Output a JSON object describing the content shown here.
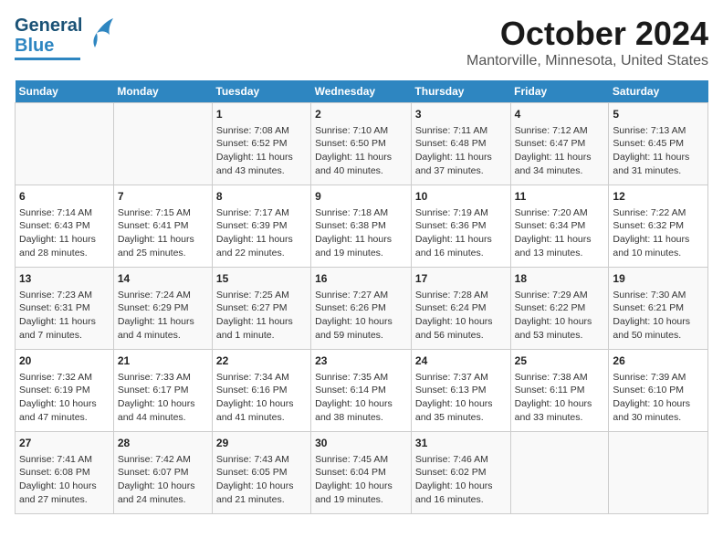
{
  "logo": {
    "line1": "General",
    "line2": "Blue"
  },
  "title": "October 2024",
  "subtitle": "Mantorville, Minnesota, United States",
  "days_of_week": [
    "Sunday",
    "Monday",
    "Tuesday",
    "Wednesday",
    "Thursday",
    "Friday",
    "Saturday"
  ],
  "weeks": [
    [
      {
        "day": "",
        "info": ""
      },
      {
        "day": "",
        "info": ""
      },
      {
        "day": "1",
        "info": "Sunrise: 7:08 AM\nSunset: 6:52 PM\nDaylight: 11 hours and 43 minutes."
      },
      {
        "day": "2",
        "info": "Sunrise: 7:10 AM\nSunset: 6:50 PM\nDaylight: 11 hours and 40 minutes."
      },
      {
        "day": "3",
        "info": "Sunrise: 7:11 AM\nSunset: 6:48 PM\nDaylight: 11 hours and 37 minutes."
      },
      {
        "day": "4",
        "info": "Sunrise: 7:12 AM\nSunset: 6:47 PM\nDaylight: 11 hours and 34 minutes."
      },
      {
        "day": "5",
        "info": "Sunrise: 7:13 AM\nSunset: 6:45 PM\nDaylight: 11 hours and 31 minutes."
      }
    ],
    [
      {
        "day": "6",
        "info": "Sunrise: 7:14 AM\nSunset: 6:43 PM\nDaylight: 11 hours and 28 minutes."
      },
      {
        "day": "7",
        "info": "Sunrise: 7:15 AM\nSunset: 6:41 PM\nDaylight: 11 hours and 25 minutes."
      },
      {
        "day": "8",
        "info": "Sunrise: 7:17 AM\nSunset: 6:39 PM\nDaylight: 11 hours and 22 minutes."
      },
      {
        "day": "9",
        "info": "Sunrise: 7:18 AM\nSunset: 6:38 PM\nDaylight: 11 hours and 19 minutes."
      },
      {
        "day": "10",
        "info": "Sunrise: 7:19 AM\nSunset: 6:36 PM\nDaylight: 11 hours and 16 minutes."
      },
      {
        "day": "11",
        "info": "Sunrise: 7:20 AM\nSunset: 6:34 PM\nDaylight: 11 hours and 13 minutes."
      },
      {
        "day": "12",
        "info": "Sunrise: 7:22 AM\nSunset: 6:32 PM\nDaylight: 11 hours and 10 minutes."
      }
    ],
    [
      {
        "day": "13",
        "info": "Sunrise: 7:23 AM\nSunset: 6:31 PM\nDaylight: 11 hours and 7 minutes."
      },
      {
        "day": "14",
        "info": "Sunrise: 7:24 AM\nSunset: 6:29 PM\nDaylight: 11 hours and 4 minutes."
      },
      {
        "day": "15",
        "info": "Sunrise: 7:25 AM\nSunset: 6:27 PM\nDaylight: 11 hours and 1 minute."
      },
      {
        "day": "16",
        "info": "Sunrise: 7:27 AM\nSunset: 6:26 PM\nDaylight: 10 hours and 59 minutes."
      },
      {
        "day": "17",
        "info": "Sunrise: 7:28 AM\nSunset: 6:24 PM\nDaylight: 10 hours and 56 minutes."
      },
      {
        "day": "18",
        "info": "Sunrise: 7:29 AM\nSunset: 6:22 PM\nDaylight: 10 hours and 53 minutes."
      },
      {
        "day": "19",
        "info": "Sunrise: 7:30 AM\nSunset: 6:21 PM\nDaylight: 10 hours and 50 minutes."
      }
    ],
    [
      {
        "day": "20",
        "info": "Sunrise: 7:32 AM\nSunset: 6:19 PM\nDaylight: 10 hours and 47 minutes."
      },
      {
        "day": "21",
        "info": "Sunrise: 7:33 AM\nSunset: 6:17 PM\nDaylight: 10 hours and 44 minutes."
      },
      {
        "day": "22",
        "info": "Sunrise: 7:34 AM\nSunset: 6:16 PM\nDaylight: 10 hours and 41 minutes."
      },
      {
        "day": "23",
        "info": "Sunrise: 7:35 AM\nSunset: 6:14 PM\nDaylight: 10 hours and 38 minutes."
      },
      {
        "day": "24",
        "info": "Sunrise: 7:37 AM\nSunset: 6:13 PM\nDaylight: 10 hours and 35 minutes."
      },
      {
        "day": "25",
        "info": "Sunrise: 7:38 AM\nSunset: 6:11 PM\nDaylight: 10 hours and 33 minutes."
      },
      {
        "day": "26",
        "info": "Sunrise: 7:39 AM\nSunset: 6:10 PM\nDaylight: 10 hours and 30 minutes."
      }
    ],
    [
      {
        "day": "27",
        "info": "Sunrise: 7:41 AM\nSunset: 6:08 PM\nDaylight: 10 hours and 27 minutes."
      },
      {
        "day": "28",
        "info": "Sunrise: 7:42 AM\nSunset: 6:07 PM\nDaylight: 10 hours and 24 minutes."
      },
      {
        "day": "29",
        "info": "Sunrise: 7:43 AM\nSunset: 6:05 PM\nDaylight: 10 hours and 21 minutes."
      },
      {
        "day": "30",
        "info": "Sunrise: 7:45 AM\nSunset: 6:04 PM\nDaylight: 10 hours and 19 minutes."
      },
      {
        "day": "31",
        "info": "Sunrise: 7:46 AM\nSunset: 6:02 PM\nDaylight: 10 hours and 16 minutes."
      },
      {
        "day": "",
        "info": ""
      },
      {
        "day": "",
        "info": ""
      }
    ]
  ]
}
